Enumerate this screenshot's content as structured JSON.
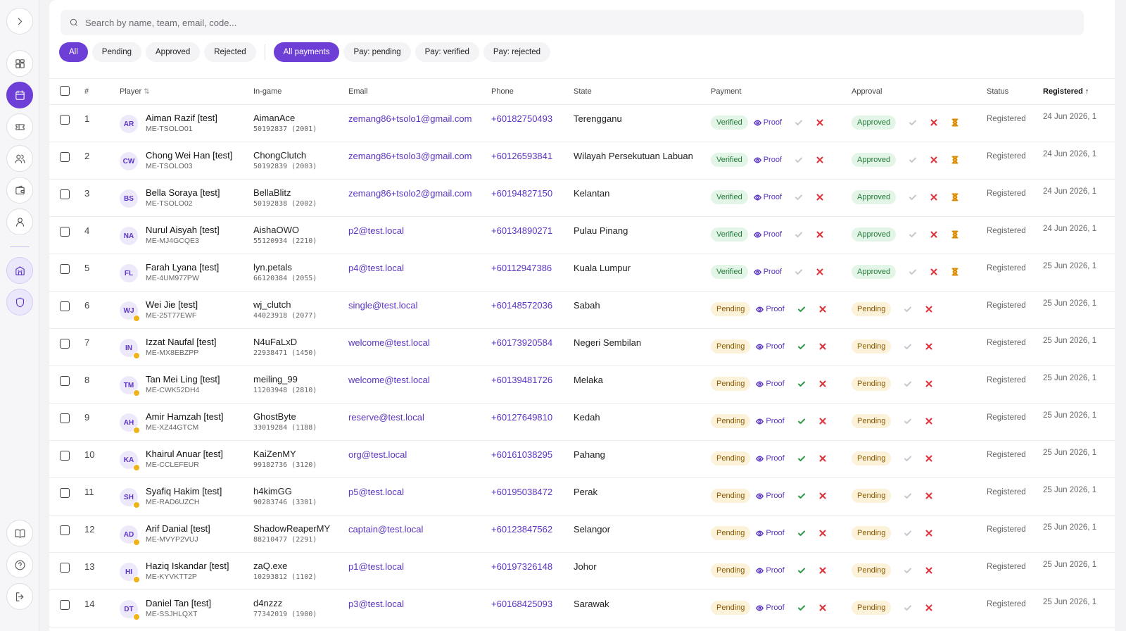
{
  "search": {
    "placeholder": "Search by name, team, email, code..."
  },
  "filters": {
    "approval": [
      "All",
      "Pending",
      "Approved",
      "Rejected"
    ],
    "payment": [
      "All payments",
      "Pay: pending",
      "Pay: verified",
      "Pay: rejected"
    ]
  },
  "columns": {
    "index": "#",
    "player": "Player",
    "ingame": "In-game",
    "email": "Email",
    "phone": "Phone",
    "state": "State",
    "payment": "Payment",
    "approval": "Approval",
    "status": "Status",
    "registered": "Registered"
  },
  "proof_label": "Proof",
  "rows": [
    {
      "n": "1",
      "initials": "AR",
      "name": "Aiman Razif [test]",
      "code": "ME-TSOLO01",
      "ign": "AimanAce",
      "ign_code": "50192837 (2001)",
      "email": "zemang86+tsolo1@gmail.com",
      "phone": "+60182750493",
      "state": "Terengganu",
      "payment": "Verified",
      "approval": "Approved",
      "status": "Registered",
      "registered": "24 Jun 2026, 1",
      "dot": false
    },
    {
      "n": "2",
      "initials": "CW",
      "name": "Chong Wei Han [test]",
      "code": "ME-TSOLO03",
      "ign": "ChongClutch",
      "ign_code": "50192839 (2003)",
      "email": "zemang86+tsolo3@gmail.com",
      "phone": "+60126593841",
      "state": "Wilayah Persekutuan Labuan",
      "payment": "Verified",
      "approval": "Approved",
      "status": "Registered",
      "registered": "24 Jun 2026, 1",
      "dot": false
    },
    {
      "n": "3",
      "initials": "BS",
      "name": "Bella Soraya [test]",
      "code": "ME-TSOLO02",
      "ign": "BellaBlitz",
      "ign_code": "50192838 (2002)",
      "email": "zemang86+tsolo2@gmail.com",
      "phone": "+60194827150",
      "state": "Kelantan",
      "payment": "Verified",
      "approval": "Approved",
      "status": "Registered",
      "registered": "24 Jun 2026, 1",
      "dot": false
    },
    {
      "n": "4",
      "initials": "NA",
      "name": "Nurul Aisyah [test]",
      "code": "ME-MJ4GCQE3",
      "ign": "AishaOWO",
      "ign_code": "55120934 (2210)",
      "email": "p2@test.local",
      "phone": "+60134890271",
      "state": "Pulau Pinang",
      "payment": "Verified",
      "approval": "Approved",
      "status": "Registered",
      "registered": "24 Jun 2026, 1",
      "dot": false
    },
    {
      "n": "5",
      "initials": "FL",
      "name": "Farah Lyana [test]",
      "code": "ME-4UM977PW",
      "ign": "lyn.petals",
      "ign_code": "66120384 (2055)",
      "email": "p4@test.local",
      "phone": "+60112947386",
      "state": "Kuala Lumpur",
      "payment": "Verified",
      "approval": "Approved",
      "status": "Registered",
      "registered": "25 Jun 2026, 1",
      "dot": false
    },
    {
      "n": "6",
      "initials": "WJ",
      "name": "Wei Jie [test]",
      "code": "ME-25T77EWF",
      "ign": "wj_clutch",
      "ign_code": "44023918 (2077)",
      "email": "single@test.local",
      "phone": "+60148572036",
      "state": "Sabah",
      "payment": "Pending",
      "approval": "Pending",
      "status": "Registered",
      "registered": "25 Jun 2026, 1",
      "dot": true
    },
    {
      "n": "7",
      "initials": "IN",
      "name": "Izzat Naufal [test]",
      "code": "ME-MX8EBZPP",
      "ign": "N4uFaLxD",
      "ign_code": "22938471 (1450)",
      "email": "welcome@test.local",
      "phone": "+60173920584",
      "state": "Negeri Sembilan",
      "payment": "Pending",
      "approval": "Pending",
      "status": "Registered",
      "registered": "25 Jun 2026, 1",
      "dot": true
    },
    {
      "n": "8",
      "initials": "TM",
      "name": "Tan Mei Ling [test]",
      "code": "ME-CWK52DH4",
      "ign": "meiling_99",
      "ign_code": "11203948 (2810)",
      "email": "welcome@test.local",
      "phone": "+60139481726",
      "state": "Melaka",
      "payment": "Pending",
      "approval": "Pending",
      "status": "Registered",
      "registered": "25 Jun 2026, 1",
      "dot": true
    },
    {
      "n": "9",
      "initials": "AH",
      "name": "Amir Hamzah [test]",
      "code": "ME-XZ44GTCM",
      "ign": "GhostByte",
      "ign_code": "33019284 (1188)",
      "email": "reserve@test.local",
      "phone": "+60127649810",
      "state": "Kedah",
      "payment": "Pending",
      "approval": "Pending",
      "status": "Registered",
      "registered": "25 Jun 2026, 1",
      "dot": true
    },
    {
      "n": "10",
      "initials": "KA",
      "name": "Khairul Anuar [test]",
      "code": "ME-CCLEFEUR",
      "ign": "KaiZenMY",
      "ign_code": "99182736 (3120)",
      "email": "org@test.local",
      "phone": "+60161038295",
      "state": "Pahang",
      "payment": "Pending",
      "approval": "Pending",
      "status": "Registered",
      "registered": "25 Jun 2026, 1",
      "dot": true
    },
    {
      "n": "11",
      "initials": "SH",
      "name": "Syafiq Hakim [test]",
      "code": "ME-RAD6UZCH",
      "ign": "h4kimGG",
      "ign_code": "90283746 (3301)",
      "email": "p5@test.local",
      "phone": "+60195038472",
      "state": "Perak",
      "payment": "Pending",
      "approval": "Pending",
      "status": "Registered",
      "registered": "25 Jun 2026, 1",
      "dot": true
    },
    {
      "n": "12",
      "initials": "AD",
      "name": "Arif Danial [test]",
      "code": "ME-MVYP2VUJ",
      "ign": "ShadowReaperMY",
      "ign_code": "88210477 (2291)",
      "email": "captain@test.local",
      "phone": "+60123847562",
      "state": "Selangor",
      "payment": "Pending",
      "approval": "Pending",
      "status": "Registered",
      "registered": "25 Jun 2026, 1",
      "dot": true
    },
    {
      "n": "13",
      "initials": "HI",
      "name": "Haziq Iskandar [test]",
      "code": "ME-KYVKTT2P",
      "ign": "zaQ.exe",
      "ign_code": "10293812 (1102)",
      "email": "p1@test.local",
      "phone": "+60197326148",
      "state": "Johor",
      "payment": "Pending",
      "approval": "Pending",
      "status": "Registered",
      "registered": "25 Jun 2026, 1",
      "dot": true
    },
    {
      "n": "14",
      "initials": "DT",
      "name": "Daniel Tan [test]",
      "code": "ME-SSJHLQXT",
      "ign": "d4nzzz",
      "ign_code": "77342019 (1900)",
      "email": "p3@test.local",
      "phone": "+60168425093",
      "state": "Sarawak",
      "payment": "Pending",
      "approval": "Pending",
      "status": "Registered",
      "registered": "25 Jun 2026, 1",
      "dot": true
    }
  ]
}
